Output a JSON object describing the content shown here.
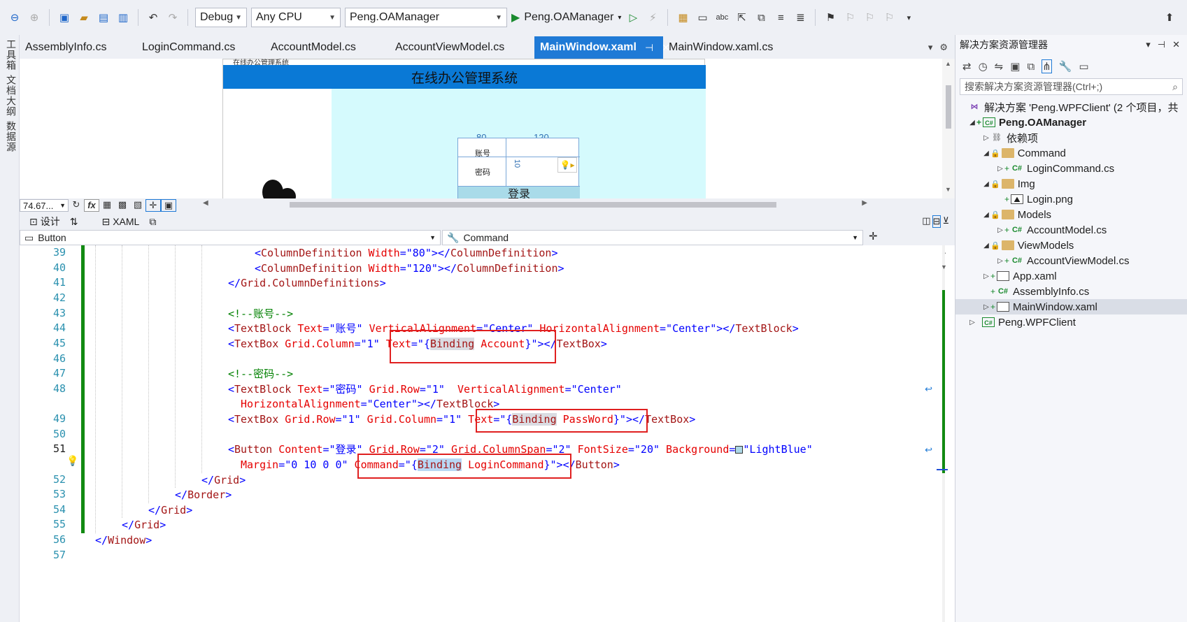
{
  "toolbar": {
    "config": "Debug",
    "platform": "Any CPU",
    "startup_project": "Peng.OAManager",
    "run_label": "Peng.OAManager"
  },
  "left_strip": [
    "工具箱",
    "文档大纲",
    "数据源"
  ],
  "tabs": [
    {
      "label": "AssemblyInfo.cs"
    },
    {
      "label": "LoginCommand.cs"
    },
    {
      "label": "AccountModel.cs"
    },
    {
      "label": "AccountViewModel.cs"
    },
    {
      "label": "MainWindow.xaml",
      "active": true
    },
    {
      "label": "MainWindow.xaml.cs"
    }
  ],
  "designer": {
    "caption": "在线办公管理系统",
    "header_title": "在线办公管理系统",
    "col1_width": "80",
    "col2_width": "120",
    "row_height": "10",
    "label_account": "账号",
    "label_password": "密码",
    "login_button": "登录",
    "zoom": "74.67..."
  },
  "split": {
    "design_tab": "设计",
    "xaml_tab": "XAML"
  },
  "nav": {
    "element": "Button",
    "member": "Command"
  },
  "code": {
    "line_numbers": [
      "39",
      "40",
      "41",
      "42",
      "43",
      "44",
      "45",
      "46",
      "47",
      "48",
      "",
      "49",
      "50",
      "51",
      "",
      "52",
      "53",
      "54",
      "55",
      "56",
      "57"
    ],
    "current_line": "51"
  },
  "solution_explorer": {
    "title": "解决方案资源管理器",
    "search_placeholder": "搜索解决方案资源管理器(Ctrl+;)",
    "solution": "解决方案 'Peng.WPFClient' (2 个项目，共",
    "project_oa": "Peng.OAManager",
    "deps": "依赖项",
    "folder_command": "Command",
    "file_logincommand": "LoginCommand.cs",
    "folder_img": "Img",
    "file_login_png": "Login.png",
    "folder_models": "Models",
    "file_accountmodel": "AccountModel.cs",
    "folder_viewmodels": "ViewModels",
    "file_accountviewmodel": "AccountViewModel.cs",
    "file_app": "App.xaml",
    "file_assemblyinfo": "AssemblyInfo.cs",
    "file_mainwindow": "MainWindow.xaml",
    "project_wpf": "Peng.WPFClient"
  }
}
